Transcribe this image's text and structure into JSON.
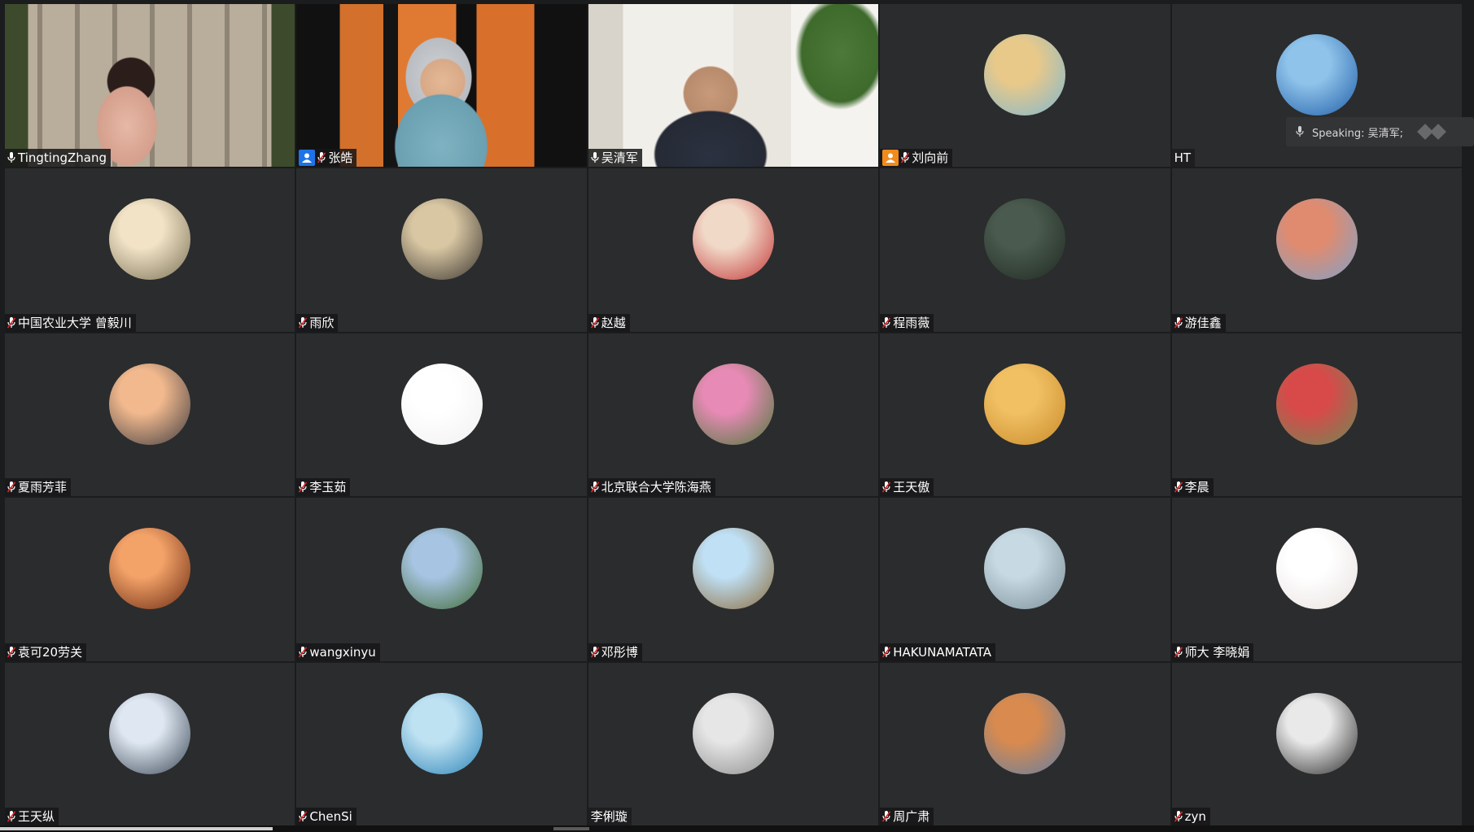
{
  "speaking_label": "Speaking: 吴清军;",
  "participants": [
    {
      "name": "TingtingZhang",
      "kind": "video",
      "mic": "on",
      "badge": "",
      "scene": "cloister"
    },
    {
      "name": "张皓",
      "kind": "video",
      "mic": "muted",
      "badge": "host-blue",
      "scene": "office"
    },
    {
      "name": "吴清军",
      "kind": "video",
      "mic": "on",
      "badge": "",
      "scene": "study",
      "active": true
    },
    {
      "name": "刘向前",
      "kind": "avatar",
      "mic": "muted",
      "badge": "host-orange",
      "avatar": [
        "#e8c98a",
        "#7fb7cf"
      ]
    },
    {
      "name": "HT",
      "kind": "avatar",
      "mic": "none",
      "badge": "",
      "avatar": [
        "#8fc3ea",
        "#1f5ea8"
      ]
    },
    {
      "name": "中国农业大学 曾毅川",
      "kind": "avatar",
      "mic": "muted",
      "badge": "",
      "avatar": [
        "#f2e3c6",
        "#7a7055"
      ]
    },
    {
      "name": "雨欣",
      "kind": "avatar",
      "mic": "muted",
      "badge": "",
      "avatar": [
        "#d9c7a3",
        "#3a3530"
      ]
    },
    {
      "name": "赵越",
      "kind": "avatar",
      "mic": "muted",
      "badge": "",
      "avatar": [
        "#f1d9c8",
        "#c23636"
      ]
    },
    {
      "name": "程雨薇",
      "kind": "avatar",
      "mic": "muted",
      "badge": "",
      "avatar": [
        "#4a5a4e",
        "#1f2a22"
      ]
    },
    {
      "name": "游佳鑫",
      "kind": "avatar",
      "mic": "muted",
      "badge": "",
      "avatar": [
        "#e08b6f",
        "#7fa2c9"
      ]
    },
    {
      "name": "夏雨芳菲",
      "kind": "avatar",
      "mic": "muted",
      "badge": "",
      "avatar": [
        "#f2b98e",
        "#3f3c3f"
      ]
    },
    {
      "name": "李玉茹",
      "kind": "avatar",
      "mic": "muted",
      "badge": "",
      "avatar": [
        "#ffffff",
        "#f0f0f0"
      ]
    },
    {
      "name": "北京联合大学陈海燕",
      "kind": "avatar",
      "mic": "muted",
      "badge": "",
      "avatar": [
        "#e88ab6",
        "#4d7a3a"
      ]
    },
    {
      "name": "王天傲",
      "kind": "avatar",
      "mic": "muted",
      "badge": "",
      "avatar": [
        "#f0c063",
        "#c98a2a"
      ]
    },
    {
      "name": "李晨",
      "kind": "avatar",
      "mic": "muted",
      "badge": "",
      "avatar": [
        "#d84a4a",
        "#6b8a55"
      ]
    },
    {
      "name": "袁可20劳关",
      "kind": "avatar",
      "mic": "muted",
      "badge": "",
      "avatar": [
        "#f3a268",
        "#6a2a12"
      ]
    },
    {
      "name": "wangxinyu",
      "kind": "avatar",
      "mic": "muted",
      "badge": "",
      "avatar": [
        "#a7c4e2",
        "#3f6b34"
      ]
    },
    {
      "name": "邓彤博",
      "kind": "avatar",
      "mic": "muted",
      "badge": "",
      "avatar": [
        "#bfe0f5",
        "#8a6a3b"
      ]
    },
    {
      "name": "HAKUNAMATATA",
      "kind": "avatar",
      "mic": "muted",
      "badge": "",
      "avatar": [
        "#c7d9e2",
        "#7a8f98"
      ]
    },
    {
      "name": "师大 李晓娟",
      "kind": "avatar",
      "mic": "muted",
      "badge": "",
      "avatar": [
        "#ffffff",
        "#e7e1de"
      ]
    },
    {
      "name": "王天纵",
      "kind": "avatar",
      "mic": "muted",
      "badge": "",
      "avatar": [
        "#dfe8f2",
        "#3a4756"
      ]
    },
    {
      "name": "ChenSi",
      "kind": "avatar",
      "mic": "muted",
      "badge": "",
      "avatar": [
        "#bfe2f2",
        "#2b83b8"
      ]
    },
    {
      "name": "李俐璇",
      "kind": "avatar",
      "mic": "none",
      "badge": "",
      "avatar": [
        "#e6e6e6",
        "#8c8c8c"
      ]
    },
    {
      "name": "周广肃",
      "kind": "avatar",
      "mic": "muted",
      "badge": "",
      "avatar": [
        "#d98a4e",
        "#5f7fa6"
      ]
    },
    {
      "name": "zyn",
      "kind": "avatar",
      "mic": "muted",
      "badge": "",
      "avatar": [
        "#e9e9e9",
        "#2a2a2a"
      ]
    }
  ]
}
